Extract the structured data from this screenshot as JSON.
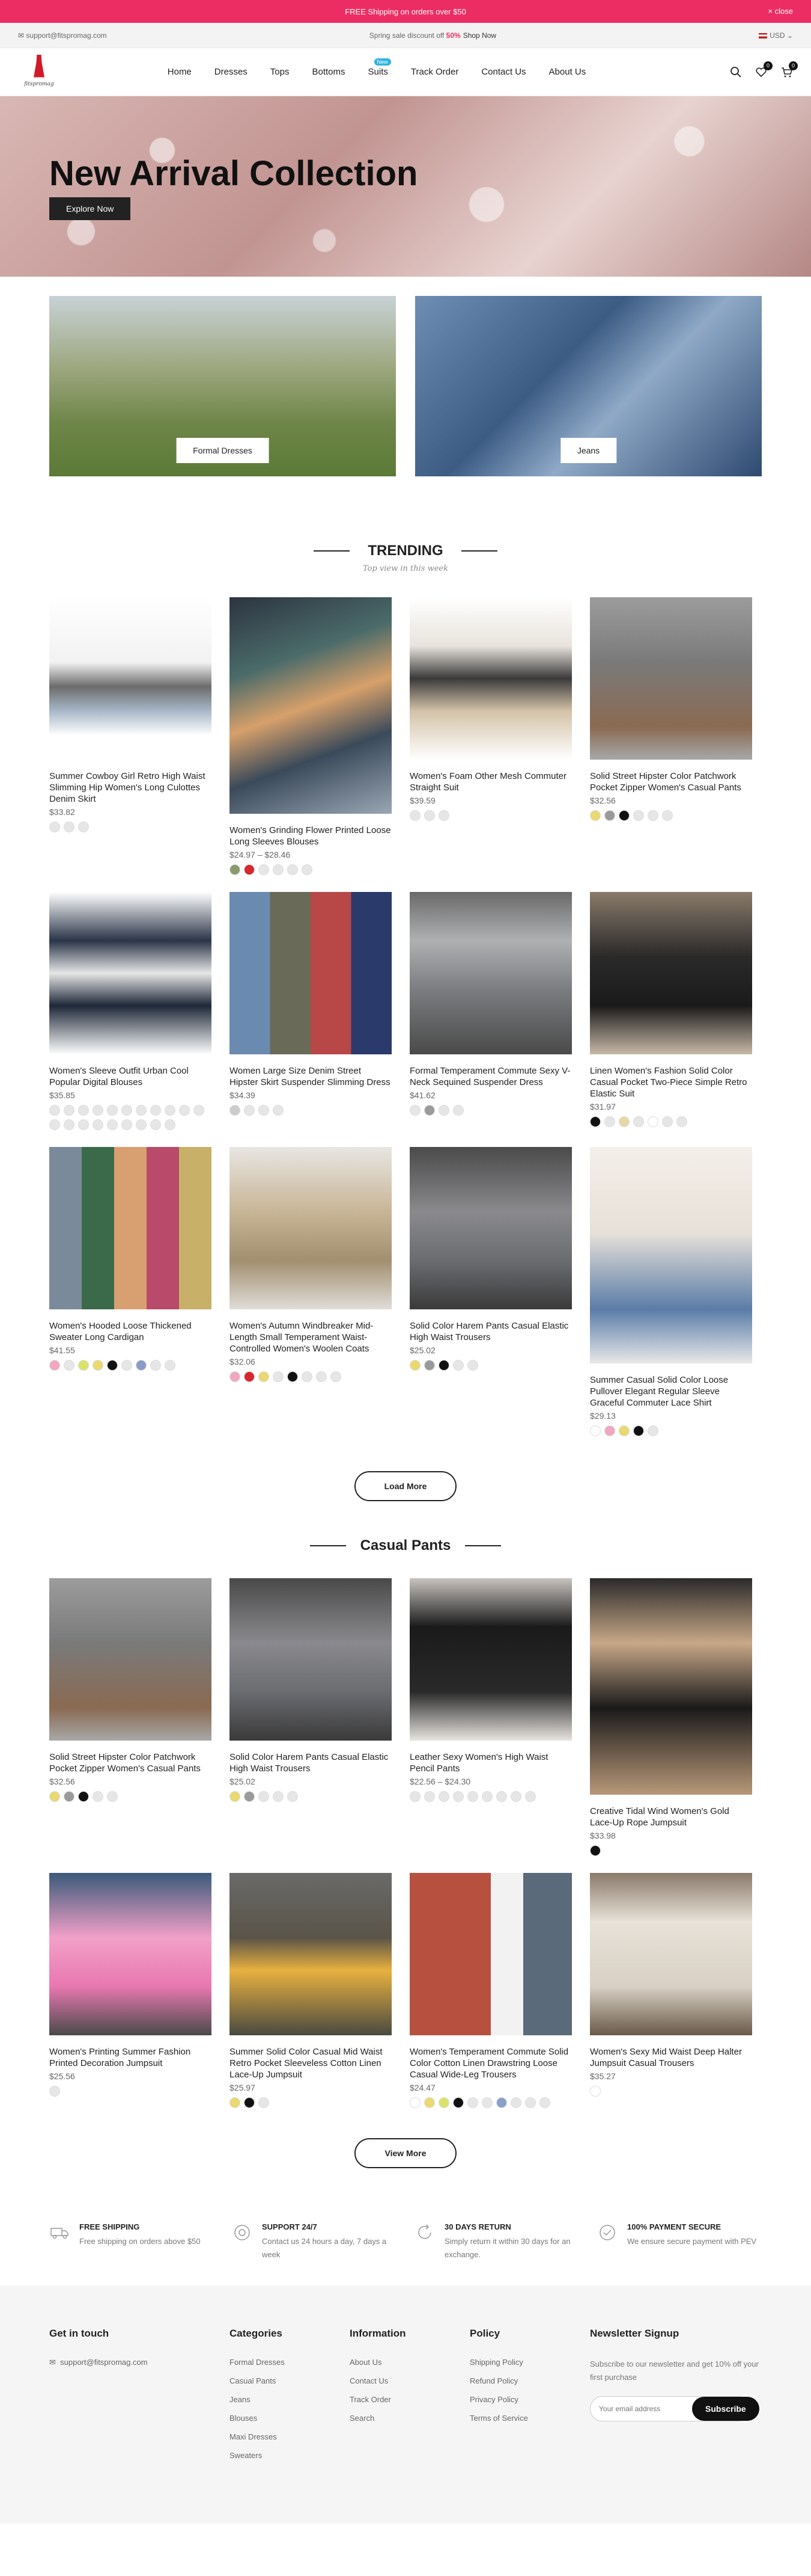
{
  "topbar": {
    "text": "FREE Shipping on orders over $50",
    "close": "× close"
  },
  "infobar": {
    "email": "support@fitspromag.com",
    "sale_prefix": "Spring sale discount off",
    "sale_pct": "50%",
    "sale_link": "Shop Now",
    "currency": "USD"
  },
  "logo": {
    "brand": "fitspromag"
  },
  "nav": {
    "items": [
      "Home",
      "Dresses",
      "Tops",
      "Bottoms",
      "Suits",
      "Track Order",
      "Contact Us",
      "About Us"
    ],
    "badge": "New"
  },
  "header": {
    "wishlist_count": "0",
    "cart_count": "0"
  },
  "hero": {
    "title": "New Arrival Collection",
    "button": "Explore Now"
  },
  "categories": [
    "Formal Dresses",
    "Jeans"
  ],
  "trending": {
    "title": "TRENDING",
    "subtitle": "Top view in this week",
    "products": [
      {
        "name": "Summer Cowboy Girl Retro High Waist Slimming Hip Women's Long Culottes Denim Skirt",
        "price": "$33.82",
        "swatches": [
          "#e6e6e6",
          "#e6e6e6",
          "#e6e6e6"
        ]
      },
      {
        "name": "Women's Grinding Flower Printed Loose Long Sleeves Blouses",
        "price": "$24.97 – $28.46",
        "swatches": [
          "#8a9a6c",
          "#d7262c",
          "#e6e6e6",
          "#e6e6e6",
          "#e6e6e6",
          "#e6e6e6"
        ]
      },
      {
        "name": "Women's Foam Other Mesh Commuter Straight Suit",
        "price": "$39.59",
        "swatches": [
          "#e6e6e6",
          "#e6e6e6",
          "#e6e6e6"
        ]
      },
      {
        "name": "Solid Street Hipster Color Patchwork Pocket Zipper Women's Casual Pants",
        "price": "$32.56",
        "swatches": [
          "#e9d970",
          "#9a9a9a",
          "#111111",
          "#e6e6e6",
          "#e6e6e6",
          "#e6e6e6"
        ]
      },
      {
        "name": "Women's Sleeve Outfit Urban Cool Popular Digital Blouses",
        "price": "$35.85",
        "swatches": [
          "#e6e6e6",
          "#e6e6e6",
          "#e6e6e6",
          "#e6e6e6",
          "#e6e6e6",
          "#e6e6e6",
          "#e6e6e6",
          "#e6e6e6",
          "#e6e6e6",
          "#e6e6e6",
          "#e6e6e6",
          "#e6e6e6",
          "#e6e6e6",
          "#e6e6e6",
          "#e6e6e6",
          "#e6e6e6",
          "#e6e6e6",
          "#e6e6e6",
          "#e6e6e6",
          "#e6e6e6"
        ]
      },
      {
        "name": "Women Large Size Denim Street Hipster Skirt Suspender Slimming Dress",
        "price": "$34.39",
        "swatches": [
          "#cccccc",
          "#e6e6e6",
          "#e6e6e6",
          "#e6e6e6"
        ]
      },
      {
        "name": "Formal Temperament Commute Sexy V-Neck Sequined Suspender Dress",
        "price": "$41.62",
        "swatches": [
          "#e6e6e6",
          "#9a9a9a",
          "#e6e6e6",
          "#e6e6e6"
        ]
      },
      {
        "name": "Linen Women's Fashion Solid Color Casual Pocket Two-Piece Simple Retro Elastic Suit",
        "price": "$31.97",
        "swatches": [
          "#111111",
          "#e6e6e6",
          "#e8d7a6",
          "#e6e6e6",
          "#ffffff",
          "#e6e6e6",
          "#e6e6e6"
        ]
      },
      {
        "name": "Women's Hooded Loose Thickened Sweater Long Cardigan",
        "price": "$41.55",
        "swatches": [
          "#f2a7c0",
          "#e6e6e6",
          "#d9e36a",
          "#e9d970",
          "#111111",
          "#e6e6e6",
          "#8a9bc7",
          "#e6e6e6",
          "#e6e6e6"
        ]
      },
      {
        "name": "Women's Autumn Windbreaker Mid-Length Small Temperament Waist-Controlled Women's Woolen Coats",
        "price": "$32.06",
        "swatches": [
          "#f2a7c0",
          "#d7262c",
          "#e9d970",
          "#e6e6e6",
          "#111111",
          "#e6e6e6",
          "#e6e6e6",
          "#e6e6e6"
        ]
      },
      {
        "name": "Solid Color Harem Pants Casual Elastic High Waist Trousers",
        "price": "$25.02",
        "swatches": [
          "#e9d970",
          "#9a9a9a",
          "#111111",
          "#e6e6e6",
          "#e6e6e6"
        ]
      },
      {
        "name": "Summer Casual Solid Color Loose Pullover Elegant Regular Sleeve Graceful Commuter Lace Shirt",
        "price": "$29.13",
        "swatches": [
          "#ffffff",
          "#f2a7c0",
          "#e9d970",
          "#111111",
          "#e6e6e6"
        ]
      }
    ],
    "button": "Load More"
  },
  "casual": {
    "title": "Casual Pants",
    "products": [
      {
        "name": "Solid Street Hipster Color Patchwork Pocket Zipper Women's Casual Pants",
        "price": "$32.56",
        "swatches": [
          "#e9d970",
          "#9a9a9a",
          "#111111",
          "#e6e6e6",
          "#e6e6e6"
        ]
      },
      {
        "name": "Solid Color Harem Pants Casual Elastic High Waist Trousers",
        "price": "$25.02",
        "swatches": [
          "#e9d970",
          "#9a9a9a",
          "#e6e6e6",
          "#e6e6e6",
          "#e6e6e6"
        ]
      },
      {
        "name": "Leather Sexy Women's High Waist Pencil Pants",
        "price": "$22.56 – $24.30",
        "swatches": [
          "#e6e6e6",
          "#e6e6e6",
          "#e6e6e6",
          "#e6e6e6",
          "#e6e6e6",
          "#e6e6e6",
          "#e6e6e6",
          "#e6e6e6",
          "#e6e6e6"
        ]
      },
      {
        "name": "Creative Tidal Wind Women's Gold Lace-Up Rope Jumpsuit",
        "price": "$33.98",
        "swatches": [
          "#111111"
        ]
      },
      {
        "name": "Women's Printing Summer Fashion Printed Decoration Jumpsuit",
        "price": "$25.56",
        "swatches": [
          "#e6e6e6"
        ]
      },
      {
        "name": "Summer Solid Color Casual Mid Waist Retro Pocket Sleeveless Cotton Linen Lace-Up Jumpsuit",
        "price": "$25.97",
        "swatches": [
          "#e9d970",
          "#111111",
          "#e6e6e6"
        ]
      },
      {
        "name": "Women's Temperament Commute Solid Color Cotton Linen Drawstring Loose Casual Wide-Leg Trousers",
        "price": "$24.47",
        "swatches": [
          "#ffffff",
          "#e9d970",
          "#d9e36a",
          "#111111",
          "#e6e6e6",
          "#e6e6e6",
          "#8aa1c7",
          "#e6e6e6",
          "#e6e6e6",
          "#e6e6e6"
        ]
      },
      {
        "name": "Women's Sexy Mid Waist Deep Halter Jumpsuit Casual Trousers",
        "price": "$35.27",
        "swatches": [
          "#ffffff"
        ]
      }
    ],
    "button": "View More"
  },
  "features": [
    {
      "title": "FREE SHIPPING",
      "text": "Free shipping on orders above $50",
      "icon": "truck-icon"
    },
    {
      "title": "SUPPORT 24/7",
      "text": "Contact us 24 hours a day, 7 days a week",
      "icon": "support-icon"
    },
    {
      "title": "30 DAYS RETURN",
      "text": "Simply return it within 30 days for an exchange.",
      "icon": "return-icon"
    },
    {
      "title": "100% PAYMENT SECURE",
      "text": "We ensure secure payment with PEV",
      "icon": "secure-icon"
    }
  ],
  "footer": {
    "contact": {
      "title": "Get in touch",
      "email": "support@fitspromag.com"
    },
    "categories": {
      "title": "Categories",
      "links": [
        "Formal Dresses",
        "Casual Pants",
        "Jeans",
        "Blouses",
        "Maxi Dresses",
        "Sweaters"
      ]
    },
    "information": {
      "title": "Information",
      "links": [
        "About Us",
        "Contact Us",
        "Track Order",
        "Search"
      ]
    },
    "policy": {
      "title": "Policy",
      "links": [
        "Shipping Policy",
        "Refund Policy",
        "Privacy Policy",
        "Terms of Service"
      ]
    },
    "newsletter": {
      "title": "Newsletter Signup",
      "text": "Subscribe to our newsletter and get 10% off your first purchase",
      "placeholder": "Your email address",
      "button": "Subscribe"
    }
  },
  "colors": {
    "accent": "#ec2d64",
    "dark": "#111111"
  }
}
